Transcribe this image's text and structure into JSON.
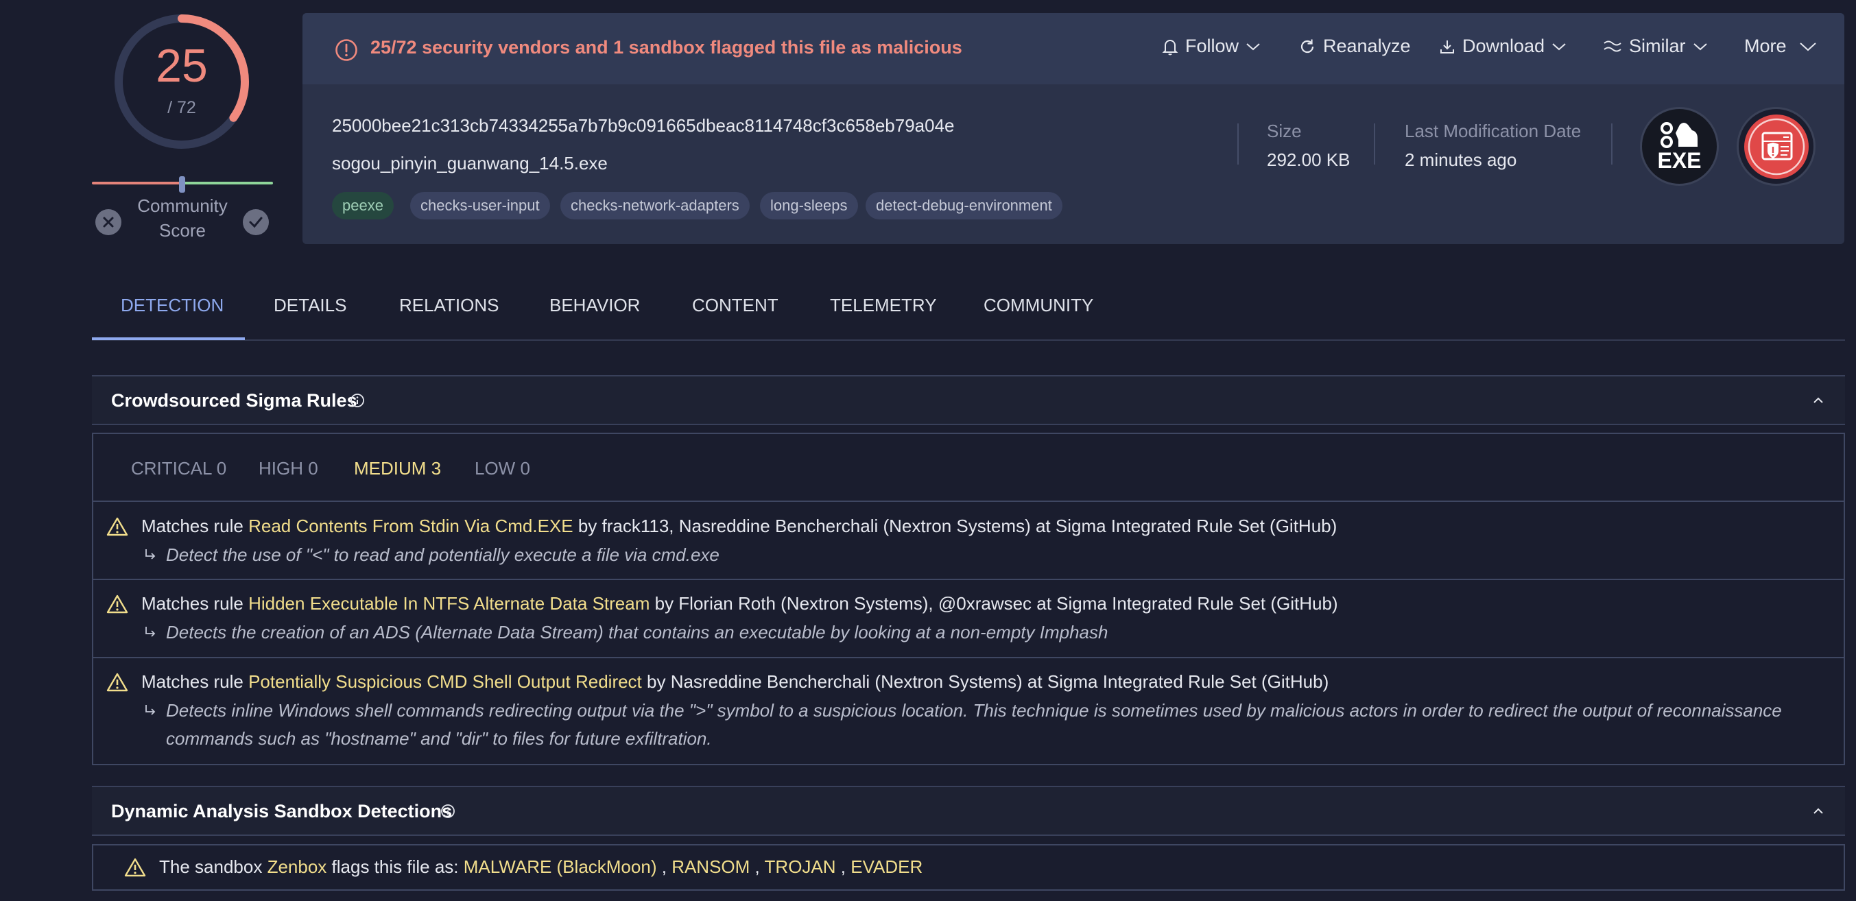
{
  "score": {
    "detected": "25",
    "total": "/ 72",
    "detected_fraction": 0.347,
    "community_label": "Community Score"
  },
  "alert": {
    "text": "25/72 security vendors and 1 sandbox flagged this file as malicious"
  },
  "actions": {
    "follow": "Follow",
    "reanalyze": "Reanalyze",
    "download": "Download",
    "similar": "Similar",
    "more": "More"
  },
  "file": {
    "hash": "25000bee21c313cb74334255a7b7b9c091665dbeac8114748cf3c658eb79a04e",
    "name": "sogou_pinyin_guanwang_14.5.exe",
    "tags": [
      "peexe",
      "checks-user-input",
      "checks-network-adapters",
      "long-sleeps",
      "detect-debug-environment"
    ],
    "size_label": "Size",
    "size_value": "292.00 KB",
    "modified_label": "Last Modification Date",
    "modified_value": "2 minutes ago",
    "type_icon_text": "EXE"
  },
  "tabs": [
    "DETECTION",
    "DETAILS",
    "RELATIONS",
    "BEHAVIOR",
    "CONTENT",
    "TELEMETRY",
    "COMMUNITY"
  ],
  "sigma": {
    "title": "Crowdsourced Sigma Rules",
    "severity_tabs": [
      "CRITICAL 0",
      "HIGH 0",
      "MEDIUM 3",
      "LOW 0"
    ],
    "rules": [
      {
        "prefix": "Matches rule",
        "name": "Read Contents From Stdin Via Cmd.EXE",
        "suffix": "by frack113, Nasreddine Bencherchali (Nextron Systems) at Sigma Integrated Rule Set (GitHub)",
        "description": "Detect the use of \"<\" to read and potentially execute a file via cmd.exe"
      },
      {
        "prefix": "Matches rule",
        "name": "Hidden Executable In NTFS Alternate Data Stream",
        "suffix": "by Florian Roth (Nextron Systems), @0xrawsec at Sigma Integrated Rule Set (GitHub)",
        "description": "Detects the creation of an ADS (Alternate Data Stream) that contains an executable by looking at a non-empty Imphash"
      },
      {
        "prefix": "Matches rule",
        "name": "Potentially Suspicious CMD Shell Output Redirect",
        "suffix": "by Nasreddine Bencherchali (Nextron Systems) at Sigma Integrated Rule Set (GitHub)",
        "description": "Detects inline Windows shell commands redirecting output via the \">\" symbol to a suspicious location. This technique is sometimes used by malicious actors in order to redirect the output of reconnaissance commands such as \"hostname\" and \"dir\" to files for future exfiltration."
      }
    ]
  },
  "sandbox": {
    "title": "Dynamic Analysis Sandbox Detections",
    "text_prefix": "The sandbox",
    "sandbox_name": "Zenbox",
    "text_middle": "flags this file as:",
    "flags": [
      "MALWARE (BlackMoon)",
      "RANSOM",
      "TROJAN",
      "EVADER"
    ],
    "separator": ","
  },
  "colors": {
    "malicious": "#f08a7e",
    "highlight": "#f2de8c",
    "accent": "#8ea9ee",
    "background": "#1a1d2e"
  }
}
